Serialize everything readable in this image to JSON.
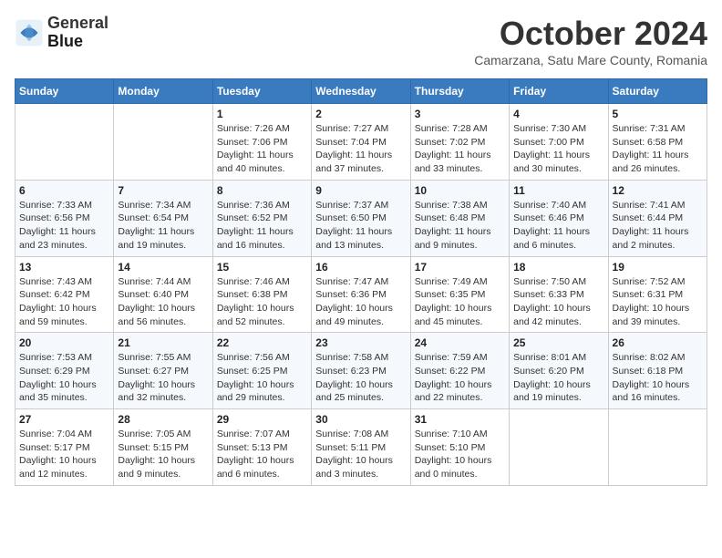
{
  "header": {
    "logo_line1": "General",
    "logo_line2": "Blue",
    "month": "October 2024",
    "location": "Camarzana, Satu Mare County, Romania"
  },
  "weekdays": [
    "Sunday",
    "Monday",
    "Tuesday",
    "Wednesday",
    "Thursday",
    "Friday",
    "Saturday"
  ],
  "weeks": [
    [
      {
        "day": "",
        "detail": ""
      },
      {
        "day": "",
        "detail": ""
      },
      {
        "day": "1",
        "detail": "Sunrise: 7:26 AM\nSunset: 7:06 PM\nDaylight: 11 hours and 40 minutes."
      },
      {
        "day": "2",
        "detail": "Sunrise: 7:27 AM\nSunset: 7:04 PM\nDaylight: 11 hours and 37 minutes."
      },
      {
        "day": "3",
        "detail": "Sunrise: 7:28 AM\nSunset: 7:02 PM\nDaylight: 11 hours and 33 minutes."
      },
      {
        "day": "4",
        "detail": "Sunrise: 7:30 AM\nSunset: 7:00 PM\nDaylight: 11 hours and 30 minutes."
      },
      {
        "day": "5",
        "detail": "Sunrise: 7:31 AM\nSunset: 6:58 PM\nDaylight: 11 hours and 26 minutes."
      }
    ],
    [
      {
        "day": "6",
        "detail": "Sunrise: 7:33 AM\nSunset: 6:56 PM\nDaylight: 11 hours and 23 minutes."
      },
      {
        "day": "7",
        "detail": "Sunrise: 7:34 AM\nSunset: 6:54 PM\nDaylight: 11 hours and 19 minutes."
      },
      {
        "day": "8",
        "detail": "Sunrise: 7:36 AM\nSunset: 6:52 PM\nDaylight: 11 hours and 16 minutes."
      },
      {
        "day": "9",
        "detail": "Sunrise: 7:37 AM\nSunset: 6:50 PM\nDaylight: 11 hours and 13 minutes."
      },
      {
        "day": "10",
        "detail": "Sunrise: 7:38 AM\nSunset: 6:48 PM\nDaylight: 11 hours and 9 minutes."
      },
      {
        "day": "11",
        "detail": "Sunrise: 7:40 AM\nSunset: 6:46 PM\nDaylight: 11 hours and 6 minutes."
      },
      {
        "day": "12",
        "detail": "Sunrise: 7:41 AM\nSunset: 6:44 PM\nDaylight: 11 hours and 2 minutes."
      }
    ],
    [
      {
        "day": "13",
        "detail": "Sunrise: 7:43 AM\nSunset: 6:42 PM\nDaylight: 10 hours and 59 minutes."
      },
      {
        "day": "14",
        "detail": "Sunrise: 7:44 AM\nSunset: 6:40 PM\nDaylight: 10 hours and 56 minutes."
      },
      {
        "day": "15",
        "detail": "Sunrise: 7:46 AM\nSunset: 6:38 PM\nDaylight: 10 hours and 52 minutes."
      },
      {
        "day": "16",
        "detail": "Sunrise: 7:47 AM\nSunset: 6:36 PM\nDaylight: 10 hours and 49 minutes."
      },
      {
        "day": "17",
        "detail": "Sunrise: 7:49 AM\nSunset: 6:35 PM\nDaylight: 10 hours and 45 minutes."
      },
      {
        "day": "18",
        "detail": "Sunrise: 7:50 AM\nSunset: 6:33 PM\nDaylight: 10 hours and 42 minutes."
      },
      {
        "day": "19",
        "detail": "Sunrise: 7:52 AM\nSunset: 6:31 PM\nDaylight: 10 hours and 39 minutes."
      }
    ],
    [
      {
        "day": "20",
        "detail": "Sunrise: 7:53 AM\nSunset: 6:29 PM\nDaylight: 10 hours and 35 minutes."
      },
      {
        "day": "21",
        "detail": "Sunrise: 7:55 AM\nSunset: 6:27 PM\nDaylight: 10 hours and 32 minutes."
      },
      {
        "day": "22",
        "detail": "Sunrise: 7:56 AM\nSunset: 6:25 PM\nDaylight: 10 hours and 29 minutes."
      },
      {
        "day": "23",
        "detail": "Sunrise: 7:58 AM\nSunset: 6:23 PM\nDaylight: 10 hours and 25 minutes."
      },
      {
        "day": "24",
        "detail": "Sunrise: 7:59 AM\nSunset: 6:22 PM\nDaylight: 10 hours and 22 minutes."
      },
      {
        "day": "25",
        "detail": "Sunrise: 8:01 AM\nSunset: 6:20 PM\nDaylight: 10 hours and 19 minutes."
      },
      {
        "day": "26",
        "detail": "Sunrise: 8:02 AM\nSunset: 6:18 PM\nDaylight: 10 hours and 16 minutes."
      }
    ],
    [
      {
        "day": "27",
        "detail": "Sunrise: 7:04 AM\nSunset: 5:17 PM\nDaylight: 10 hours and 12 minutes."
      },
      {
        "day": "28",
        "detail": "Sunrise: 7:05 AM\nSunset: 5:15 PM\nDaylight: 10 hours and 9 minutes."
      },
      {
        "day": "29",
        "detail": "Sunrise: 7:07 AM\nSunset: 5:13 PM\nDaylight: 10 hours and 6 minutes."
      },
      {
        "day": "30",
        "detail": "Sunrise: 7:08 AM\nSunset: 5:11 PM\nDaylight: 10 hours and 3 minutes."
      },
      {
        "day": "31",
        "detail": "Sunrise: 7:10 AM\nSunset: 5:10 PM\nDaylight: 10 hours and 0 minutes."
      },
      {
        "day": "",
        "detail": ""
      },
      {
        "day": "",
        "detail": ""
      }
    ]
  ]
}
